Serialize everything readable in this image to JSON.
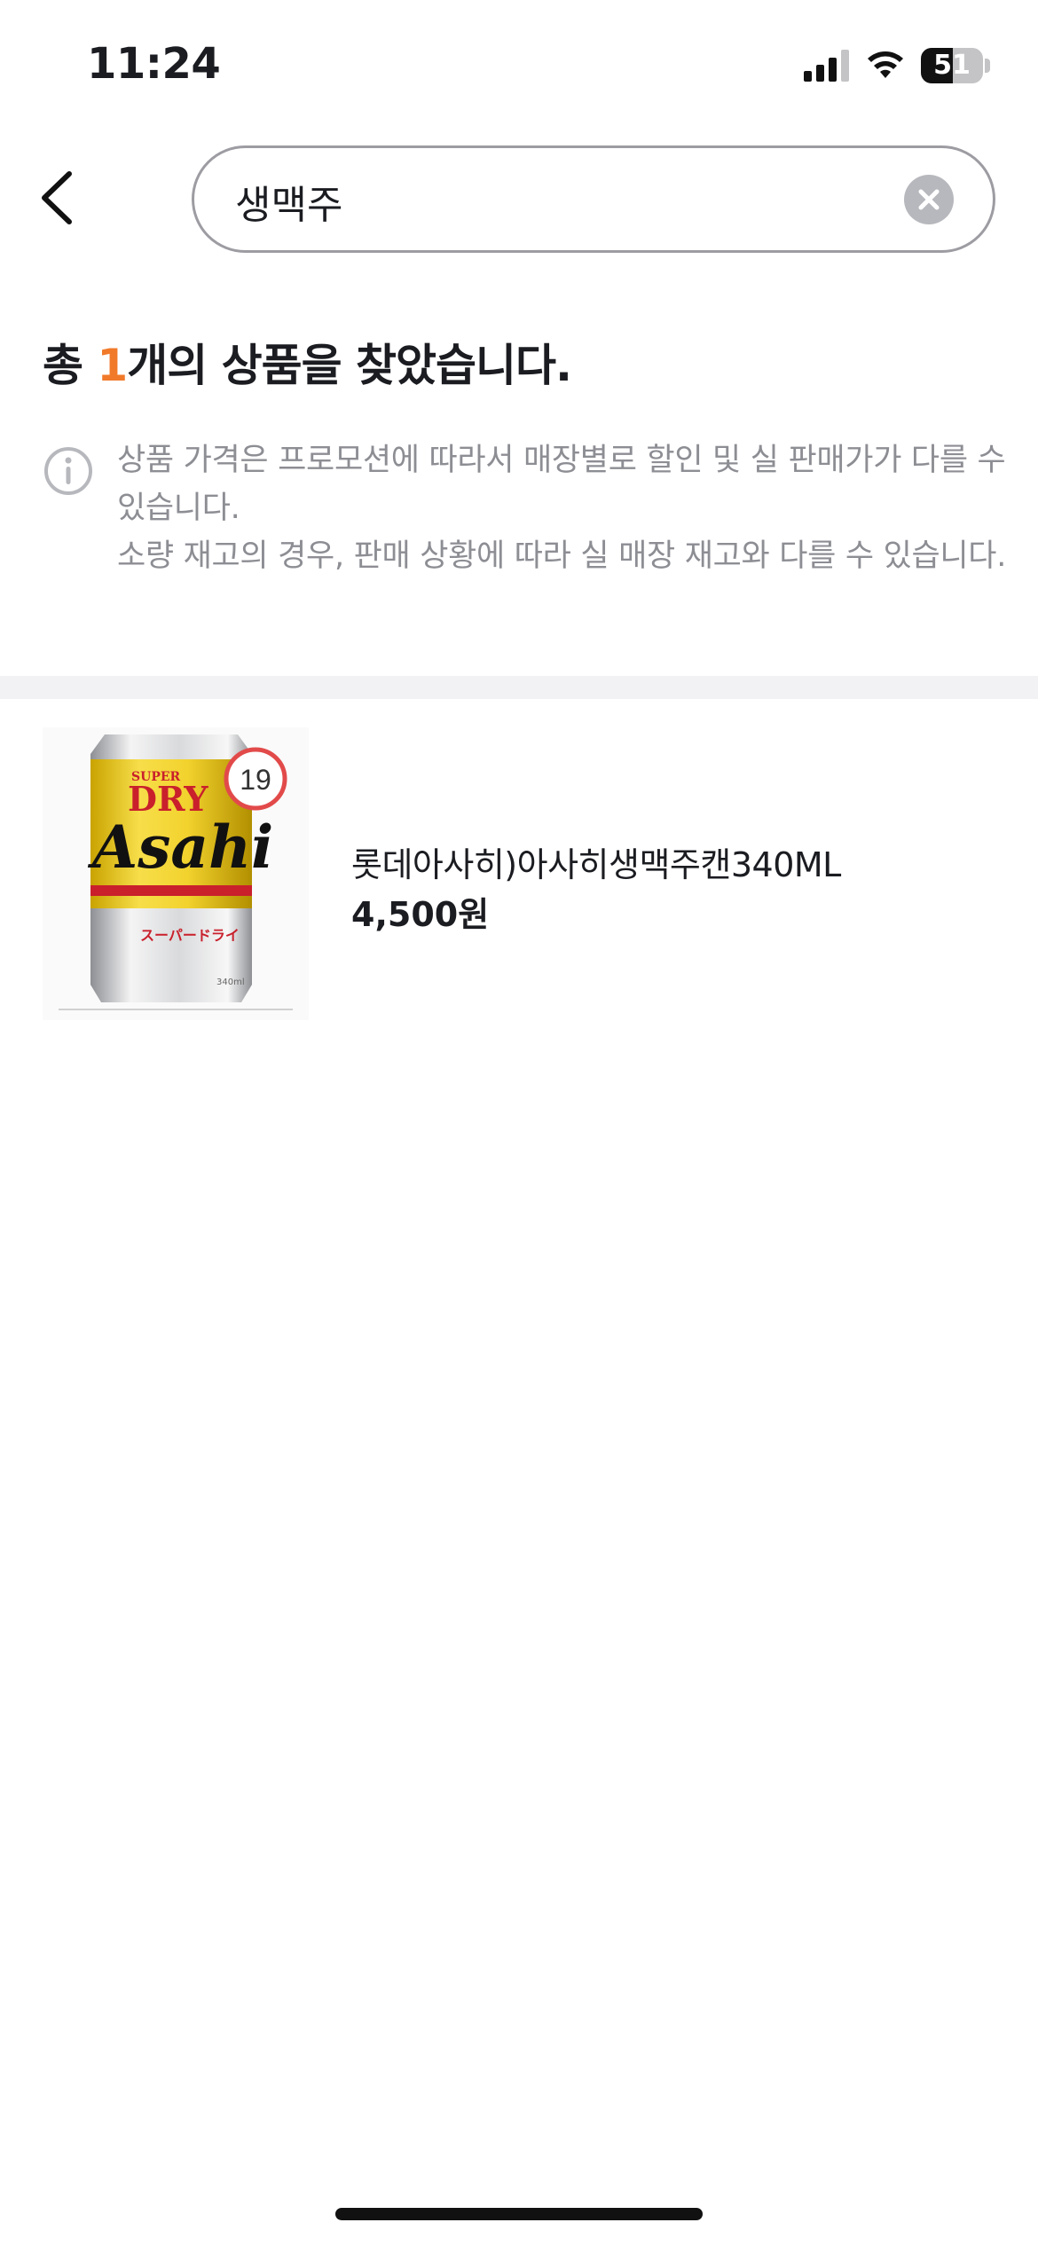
{
  "status_bar": {
    "time": "11:24",
    "battery_level": "51",
    "icons": [
      "signal-icon",
      "wifi-icon",
      "battery-icon"
    ]
  },
  "header": {
    "back_icon": "chevron-left-icon",
    "search": {
      "value": "생맥주",
      "clear_icon": "clear-circle-icon"
    }
  },
  "results": {
    "title_prefix": "총 ",
    "count": "1",
    "title_suffix": "개의 상품을 찾았습니다."
  },
  "notice": {
    "icon": "info-icon",
    "line1": "상품 가격은 프로모션에 따라서 매장별로 할인 및 실 판매가가 다를 수 있습니다.",
    "line2": "소량 재고의 경우, 판매 상황에 따라 실 매장 재고와 다를 수 있습니다."
  },
  "products": [
    {
      "name": "롯데아사히)아사히생맥주캔340ML",
      "price": "4,500원",
      "age_badge": "19",
      "image": {
        "label_super": "SUPER",
        "label_dry": "DRY",
        "label_brand": "Asahi",
        "label_katakana": "スーパードライ",
        "label_volume": "340ml"
      }
    }
  ],
  "colors": {
    "accent": "#f17a2a",
    "text_primary": "#1b1c21",
    "text_secondary": "#8d8e94",
    "badge_red": "#e24a4a",
    "divider": "#f2f2f5"
  }
}
